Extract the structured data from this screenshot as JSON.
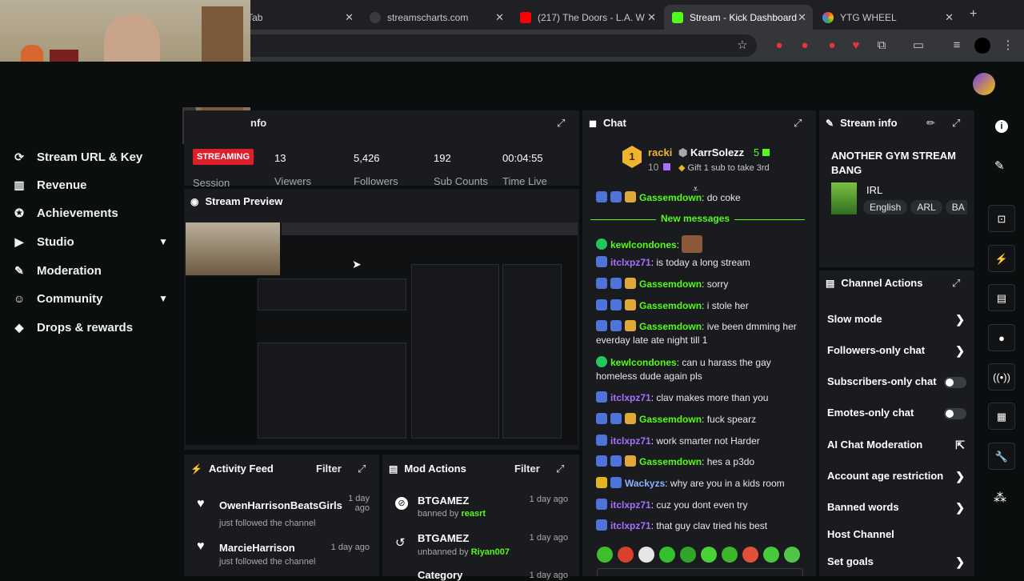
{
  "browser": {
    "tabs": [
      {
        "title": "v Tab"
      },
      {
        "title": "streamscharts.com"
      },
      {
        "title": "(217) The Doors - L.A. W"
      },
      {
        "title": "Stream - Kick Dashboard"
      },
      {
        "title": "YTG WHEEL"
      }
    ],
    "new_tab": "+"
  },
  "sidebar": {
    "items": [
      {
        "label": "Stream URL & Key",
        "icon": "link-icon"
      },
      {
        "label": "Revenue",
        "icon": "chart-icon"
      },
      {
        "label": "Achievements",
        "icon": "trophy-icon"
      },
      {
        "label": "Studio",
        "icon": "video-icon"
      },
      {
        "label": "Moderation",
        "icon": "wrench-icon"
      },
      {
        "label": "Community",
        "icon": "people-icon"
      },
      {
        "label": "Drops & rewards",
        "icon": "gift-icon"
      }
    ]
  },
  "session": {
    "header": "nfo",
    "status": "STREAMING",
    "status_label": "Session",
    "stats": [
      {
        "value": "13",
        "label": "Viewers"
      },
      {
        "value": "5,426",
        "label": "Followers"
      },
      {
        "value": "192",
        "label": "Sub Counts"
      },
      {
        "value": "00:04:55",
        "label": "Time Live"
      }
    ]
  },
  "preview": {
    "title": "Stream Preview"
  },
  "activity": {
    "title": "Activity Feed",
    "filter": "Filter",
    "items": [
      {
        "name": "OwenHarrisonBeatsGirls",
        "action": "just followed the channel",
        "time": "1 day ago"
      },
      {
        "name": "MarcieHarrison",
        "action": "just followed the channel",
        "time": "1 day ago"
      }
    ]
  },
  "mod_actions": {
    "title": "Mod Actions",
    "filter": "Filter",
    "items": [
      {
        "name": "BTGAMEZ",
        "action_prefix": "banned by",
        "actor": "reasrt",
        "time": "1 day ago"
      },
      {
        "name": "BTGAMEZ",
        "action_prefix": "unbanned by",
        "actor": "Riyan007",
        "time": "1 day ago"
      },
      {
        "name": "Category",
        "action_prefix": "",
        "actor": "",
        "time": "1 day ago"
      }
    ]
  },
  "chat": {
    "title": "Chat",
    "pinned": {
      "rank": "1",
      "gifter_name": "racki",
      "gifter_count": "10",
      "target_name": "KarrSolezz",
      "target_count": "5",
      "note": "Gift 1 sub to take 3rd"
    },
    "new_messages_label": "New messages",
    "messages": [
      {
        "user": "Gassemdown",
        "text": "do coke",
        "color": "green"
      },
      {
        "user": "kewlcondones",
        "text": "",
        "color": "green"
      },
      {
        "user": "itclxpz71",
        "text": "is today a long stream",
        "color": "purple"
      },
      {
        "user": "Gassemdown",
        "text": "sorry",
        "color": "green"
      },
      {
        "user": "Gassemdown",
        "text": "i stole her",
        "color": "green"
      },
      {
        "user": "Gassemdown",
        "text": "ive been dmming her everday late ate night till 1",
        "color": "green"
      },
      {
        "user": "kewlcondones",
        "text": "can u harass the gay homeless dude again pls",
        "color": "green"
      },
      {
        "user": "itclxpz71",
        "text": "clav makes more than you",
        "color": "purple"
      },
      {
        "user": "Gassemdown",
        "text": "fuck spearz",
        "color": "green"
      },
      {
        "user": "itclxpz71",
        "text": "work smarter not Harder",
        "color": "purple"
      },
      {
        "user": "Gassemdown",
        "text": "hes a p3do",
        "color": "green"
      },
      {
        "user": "Wackyzs",
        "text": "why are you in a kids room",
        "color": "blue"
      },
      {
        "user": "itclxpz71",
        "text": "cuz you dont even try",
        "color": "purple"
      },
      {
        "user": "itclxpz71",
        "text": "that guy clav tried his best",
        "color": "purple"
      }
    ]
  },
  "stream_info": {
    "title": "Stream info",
    "stream_title": "ANOTHER GYM STREAM BANG",
    "category": "IRL",
    "tags": [
      "English",
      "ARL",
      "BA"
    ]
  },
  "channel_actions": {
    "title": "Channel Actions",
    "items": [
      {
        "label": "Slow mode",
        "control": "arrow"
      },
      {
        "label": "Followers-only chat",
        "control": "arrow"
      },
      {
        "label": "Subscribers-only chat",
        "control": "toggle"
      },
      {
        "label": "Emotes-only chat",
        "control": "toggle"
      },
      {
        "label": "AI Chat Moderation",
        "control": "external"
      },
      {
        "label": "Account age restriction",
        "control": "arrow"
      },
      {
        "label": "Banned words",
        "control": "arrow"
      },
      {
        "label": "Host Channel",
        "control": "none"
      },
      {
        "label": "Set goals",
        "control": "arrow"
      }
    ]
  },
  "colors": {
    "accent": "#53fc18",
    "panel": "#191b1f",
    "background": "#0b0e0f",
    "streaming_badge": "#e11d2a"
  }
}
